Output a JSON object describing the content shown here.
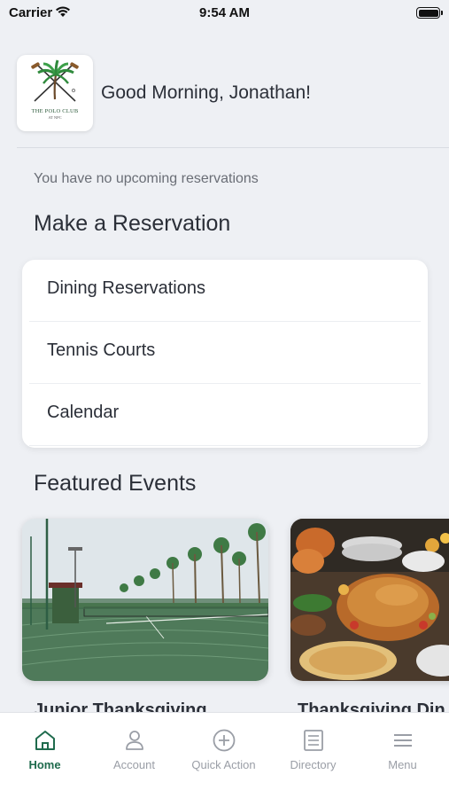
{
  "status_bar": {
    "carrier": "Carrier",
    "time": "9:54 AM"
  },
  "header": {
    "logo_text": "THE POLO CLUB",
    "logo_sub": "AT NPC",
    "greeting": "Good Morning, Jonathan!"
  },
  "reservations_status": "You have no upcoming reservations",
  "make_reservation": {
    "title": "Make a Reservation",
    "items": [
      {
        "label": "Dining Reservations"
      },
      {
        "label": "Tennis Courts"
      },
      {
        "label": "Calendar"
      }
    ]
  },
  "featured_events": {
    "title": "Featured Events",
    "events": [
      {
        "title": "Junior Thanksgiving"
      },
      {
        "title": "Thanksgiving Din"
      }
    ]
  },
  "tab_bar": {
    "active_tab": "Home",
    "tabs": [
      {
        "label": "Home",
        "icon": "home-icon"
      },
      {
        "label": "Account",
        "icon": "person-icon"
      },
      {
        "label": "Quick Action",
        "icon": "plus-circle-icon"
      },
      {
        "label": "Directory",
        "icon": "list-icon"
      },
      {
        "label": "Menu",
        "icon": "hamburger-icon"
      }
    ]
  },
  "colors": {
    "accent": "#1f6b4d",
    "background": "#eef0f4",
    "tab_inactive": "#9a9ea6"
  }
}
